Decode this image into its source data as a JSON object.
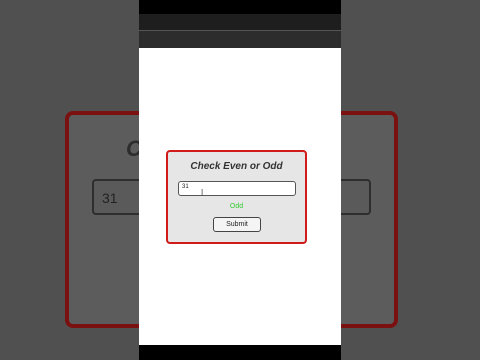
{
  "app": {
    "title": "Check Even or Odd",
    "input_value": "31",
    "result": "Odd",
    "submit_label": "Submit"
  },
  "background": {
    "title_partial": "C",
    "input_value": "31"
  },
  "icons": {
    "text_cursor": "text-cursor-icon"
  },
  "colors": {
    "card_border": "#d11a1a",
    "result_text": "#33cc33"
  }
}
